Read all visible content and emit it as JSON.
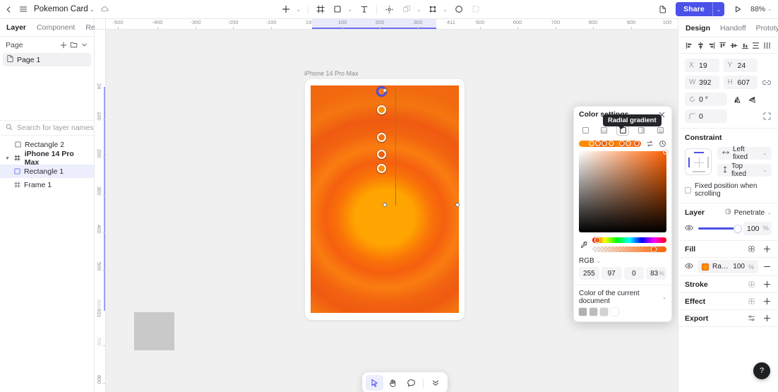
{
  "topbar": {
    "back_icon": "chevron-left-icon",
    "menu_icon": "hamburger-menu-icon",
    "doc_title": "Pokemon Card",
    "doc_caret": "⌄",
    "cloud_icon": "cloud-sync-icon",
    "tools": [
      {
        "name": "add-tool",
        "glyph": "+",
        "caret": true
      },
      {
        "name": "frame-tool",
        "glyph": "frame",
        "caret": false
      },
      {
        "name": "shape-tool",
        "glyph": "square",
        "caret": true
      },
      {
        "name": "text-tool",
        "glyph": "T",
        "caret": false
      },
      {
        "name": "vector-tool",
        "glyph": "pen",
        "caret": false
      },
      {
        "name": "component-tool",
        "glyph": "copies",
        "caret": true
      },
      {
        "name": "mask-tool",
        "glyph": "scale",
        "caret": true
      },
      {
        "name": "ellipse-tool",
        "glyph": "circle",
        "caret": false
      },
      {
        "name": "slice-tool",
        "glyph": "slice",
        "caret": false
      }
    ],
    "export_icon": "export-icon",
    "share_label": "Share",
    "share_caret": "⌄",
    "play_icon": "play-preview-icon",
    "zoom_level": "88%",
    "zoom_caret": "⌄"
  },
  "left_panel": {
    "tabs": [
      {
        "label": "Layer",
        "active": true
      },
      {
        "label": "Component",
        "active": false
      },
      {
        "label": "Resource",
        "active": false
      }
    ],
    "page_section_title": "Page",
    "page_actions": [
      "add-page-icon",
      "new-folder-icon",
      "collapse-icon"
    ],
    "pages": [
      {
        "label": "Page 1",
        "icon": "page-icon",
        "selected": true
      }
    ],
    "search_placeholder": "Search for layer names",
    "search_value": "",
    "search_icon": "search-icon",
    "filter_icon": "layer-filter-icon",
    "layers": [
      {
        "label": "Rectangle 2",
        "icon": "rectangle-icon",
        "indent": 0,
        "selected": false,
        "bold": false,
        "expandable": false
      },
      {
        "label": "iPhone 14 Pro Max",
        "icon": "frame-icon",
        "indent": 0,
        "selected": false,
        "bold": true,
        "expandable": true
      },
      {
        "label": "Rectangle 1",
        "icon": "rectangle-icon",
        "indent": 1,
        "selected": true,
        "bold": false,
        "expandable": false
      },
      {
        "label": "Frame 1",
        "icon": "frame-icon",
        "indent": 1,
        "selected": false,
        "bold": false,
        "expandable": false
      }
    ]
  },
  "canvas": {
    "frame_label": "iPhone 14 Pro Max",
    "ruler_h_ticks": [
      "-500",
      "-400",
      "-300",
      "-200",
      "-100",
      "19",
      "100",
      "200",
      "300",
      "411",
      "500",
      "600",
      "700",
      "800",
      "900",
      "100"
    ],
    "ruler_v_ticks": [
      "24",
      "100",
      "200",
      "300",
      "400",
      "500",
      "600",
      "631",
      "700",
      "800"
    ],
    "ruler_v_dim": [
      "600",
      "700"
    ],
    "selection_x": "19",
    "selection_y": "24"
  },
  "float_toolbar": {
    "buttons": [
      {
        "name": "cursor-tool",
        "icon": "cursor-icon",
        "active": true
      },
      {
        "name": "hand-tool",
        "icon": "hand-icon",
        "active": false
      },
      {
        "name": "comment-tool",
        "icon": "comment-bubble-icon",
        "active": false
      },
      {
        "name": "more-tools",
        "icon": "chevron-double-down-icon",
        "active": false
      }
    ]
  },
  "right_panel": {
    "tabs": [
      {
        "label": "Design",
        "active": true
      },
      {
        "label": "Handoff",
        "active": false
      },
      {
        "label": "Prototype",
        "active": false
      }
    ],
    "align_icons": [
      "align-left-icon",
      "align-horizontal-center-icon",
      "align-right-icon",
      "align-top-icon",
      "align-vertical-center-icon",
      "align-bottom-icon",
      "distribute-vertical-icon",
      "distribute-horizontal-icon"
    ],
    "geometry": {
      "x_key": "X",
      "x_value": "19",
      "y_key": "Y",
      "y_value": "24",
      "w_key": "W",
      "w_value": "392",
      "h_key": "H",
      "h_value": "607",
      "link_icon": "link-ratio-icon",
      "rotation_key": "rotate-icon",
      "rotation_value": "0 °",
      "flip_h_icon": "flip-horizontal-icon",
      "flip_v_icon": "flip-vertical-icon",
      "corner_key": "corner-radius-icon",
      "corner_value": "0",
      "corner_detail_icon": "independent-corners-icon"
    },
    "constraint": {
      "title": "Constraint",
      "horizontal": "Left fixed",
      "horizontal_icon": "horizontal-arrow-icon",
      "vertical": "Top fixed",
      "vertical_icon": "vertical-arrow-icon",
      "fixed_scroll_label": "Fixed position when scrolling",
      "fixed_scroll_checked": false
    },
    "layer": {
      "title": "Layer",
      "blend_mode": "Penetrate",
      "blend_icon": "blend-mode-icon",
      "visibility_icon": "eye-icon",
      "opacity": "100",
      "opacity_unit": "%"
    },
    "fill": {
      "title": "Fill",
      "grid_icon": "fill-styles-icon",
      "add_icon": "add-fill-icon",
      "items": [
        {
          "visibility_icon": "eye-icon",
          "swatch_color": "#f5710a",
          "name": "Radial gr...",
          "opacity": "100",
          "unit": "%",
          "remove_icon": "remove-fill-icon"
        }
      ]
    },
    "sections": [
      {
        "title": "Stroke",
        "icons": [
          "stroke-styles-icon",
          "add-stroke-icon"
        ]
      },
      {
        "title": "Effect",
        "icons": [
          "effect-styles-icon",
          "add-effect-icon"
        ]
      },
      {
        "title": "Export",
        "icons": [
          "export-settings-icon",
          "add-export-icon"
        ]
      }
    ]
  },
  "color_picker": {
    "title": "Color settings",
    "close_icon": "close-icon",
    "tooltip": "Radial gradient",
    "types": [
      {
        "name": "solid-fill-type",
        "active": false
      },
      {
        "name": "linear-gradient-type",
        "active": false
      },
      {
        "name": "radial-gradient-type",
        "active": true
      },
      {
        "name": "angular-gradient-type",
        "active": false
      },
      {
        "name": "image-fill-type",
        "active": false
      }
    ],
    "gradient_stops": [
      {
        "pos": 20,
        "color": "#ff8c00"
      },
      {
        "pos": 31,
        "color": "#f7700c"
      },
      {
        "pos": 41,
        "color": "#ef5d10"
      },
      {
        "pos": 52,
        "color": "#ff8a00"
      },
      {
        "pos": 69,
        "color": "#f4640f"
      },
      {
        "pos": 80,
        "color": "#ff7b0d"
      },
      {
        "pos": 93,
        "color": "#f15e0e"
      }
    ],
    "reverse_icon": "reverse-gradient-icon",
    "rotate_icon": "rotate-gradient-icon",
    "eyedropper_icon": "eyedropper-icon",
    "color_mode": "RGB",
    "mode_caret": "⌄",
    "values": [
      {
        "name": "red-channel",
        "value": "255"
      },
      {
        "name": "green-channel",
        "value": "97"
      },
      {
        "name": "blue-channel",
        "value": "0"
      },
      {
        "name": "alpha-channel",
        "value": "83",
        "unit": "%"
      }
    ],
    "doc_colors_label": "Color of the current document",
    "doc_colors_caret": "⌄",
    "doc_swatches": [
      "#b0b0b0",
      "#bcbcbc",
      "#d2d2d2",
      "#ffffff"
    ]
  },
  "help": {
    "icon": "question-mark-icon",
    "label": "?"
  },
  "colors": {
    "accent": "#4b51e8",
    "gradient_inner": "#ffa400",
    "gradient_outer": "#f1670f",
    "canvas_bg": "#f0f0f0"
  }
}
